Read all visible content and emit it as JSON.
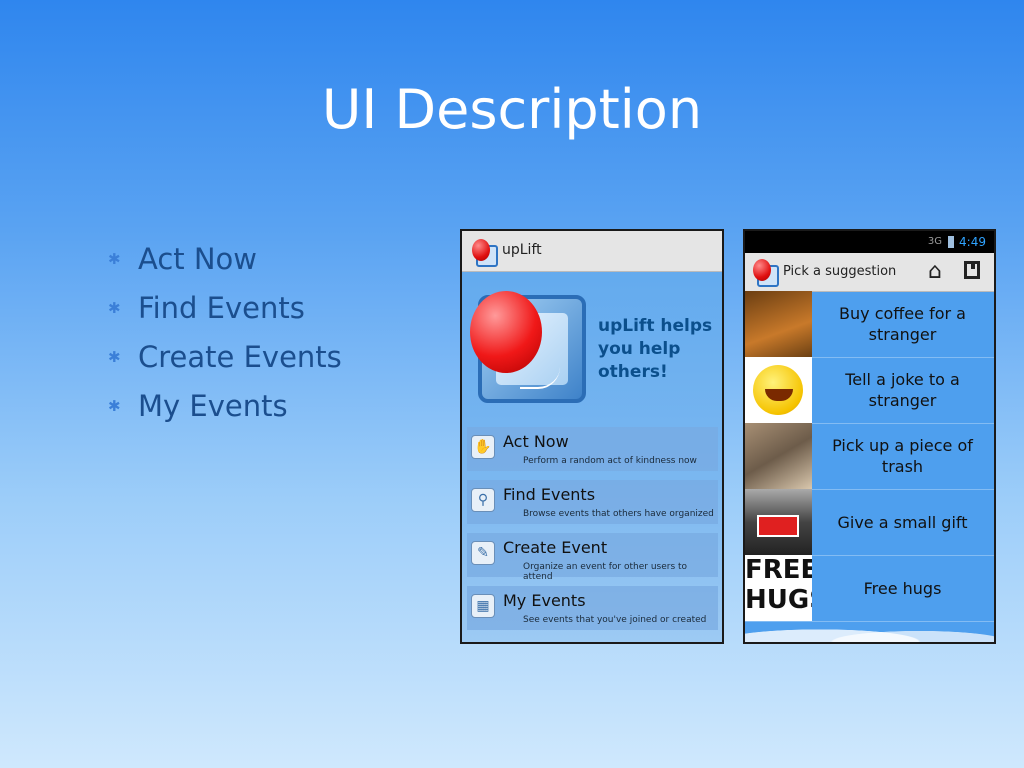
{
  "slide": {
    "title": "UI Description"
  },
  "bullets": [
    {
      "label": "Act Now"
    },
    {
      "label": "Find Events"
    },
    {
      "label": "Create Events"
    },
    {
      "label": "My Events"
    }
  ],
  "phone1": {
    "app_title": "upLift",
    "tagline": "upLift helps you help others!",
    "menu": [
      {
        "label": "Act Now",
        "sub": "Perform a random act of kindness now",
        "icon": "handshake-icon"
      },
      {
        "label": "Find Events",
        "sub": "Browse events that others have organized",
        "icon": "magnifier-icon"
      },
      {
        "label": "Create Event",
        "sub": "Organize an event for other users to attend",
        "icon": "pencil-icon"
      },
      {
        "label": "My Events",
        "sub": "See events that you've joined or created",
        "icon": "calendar-icon"
      }
    ]
  },
  "phone2": {
    "status": {
      "network": "3G",
      "time": "4:49"
    },
    "title": "Pick a suggestion",
    "suggestions": [
      {
        "text": "Buy coffee for a stranger"
      },
      {
        "text": "Tell a joke to a stranger"
      },
      {
        "text": "Pick up a piece of trash"
      },
      {
        "text": "Give a small gift"
      },
      {
        "text": "Free hugs"
      }
    ],
    "hugs_thumb_text": "FREE HUGS"
  }
}
